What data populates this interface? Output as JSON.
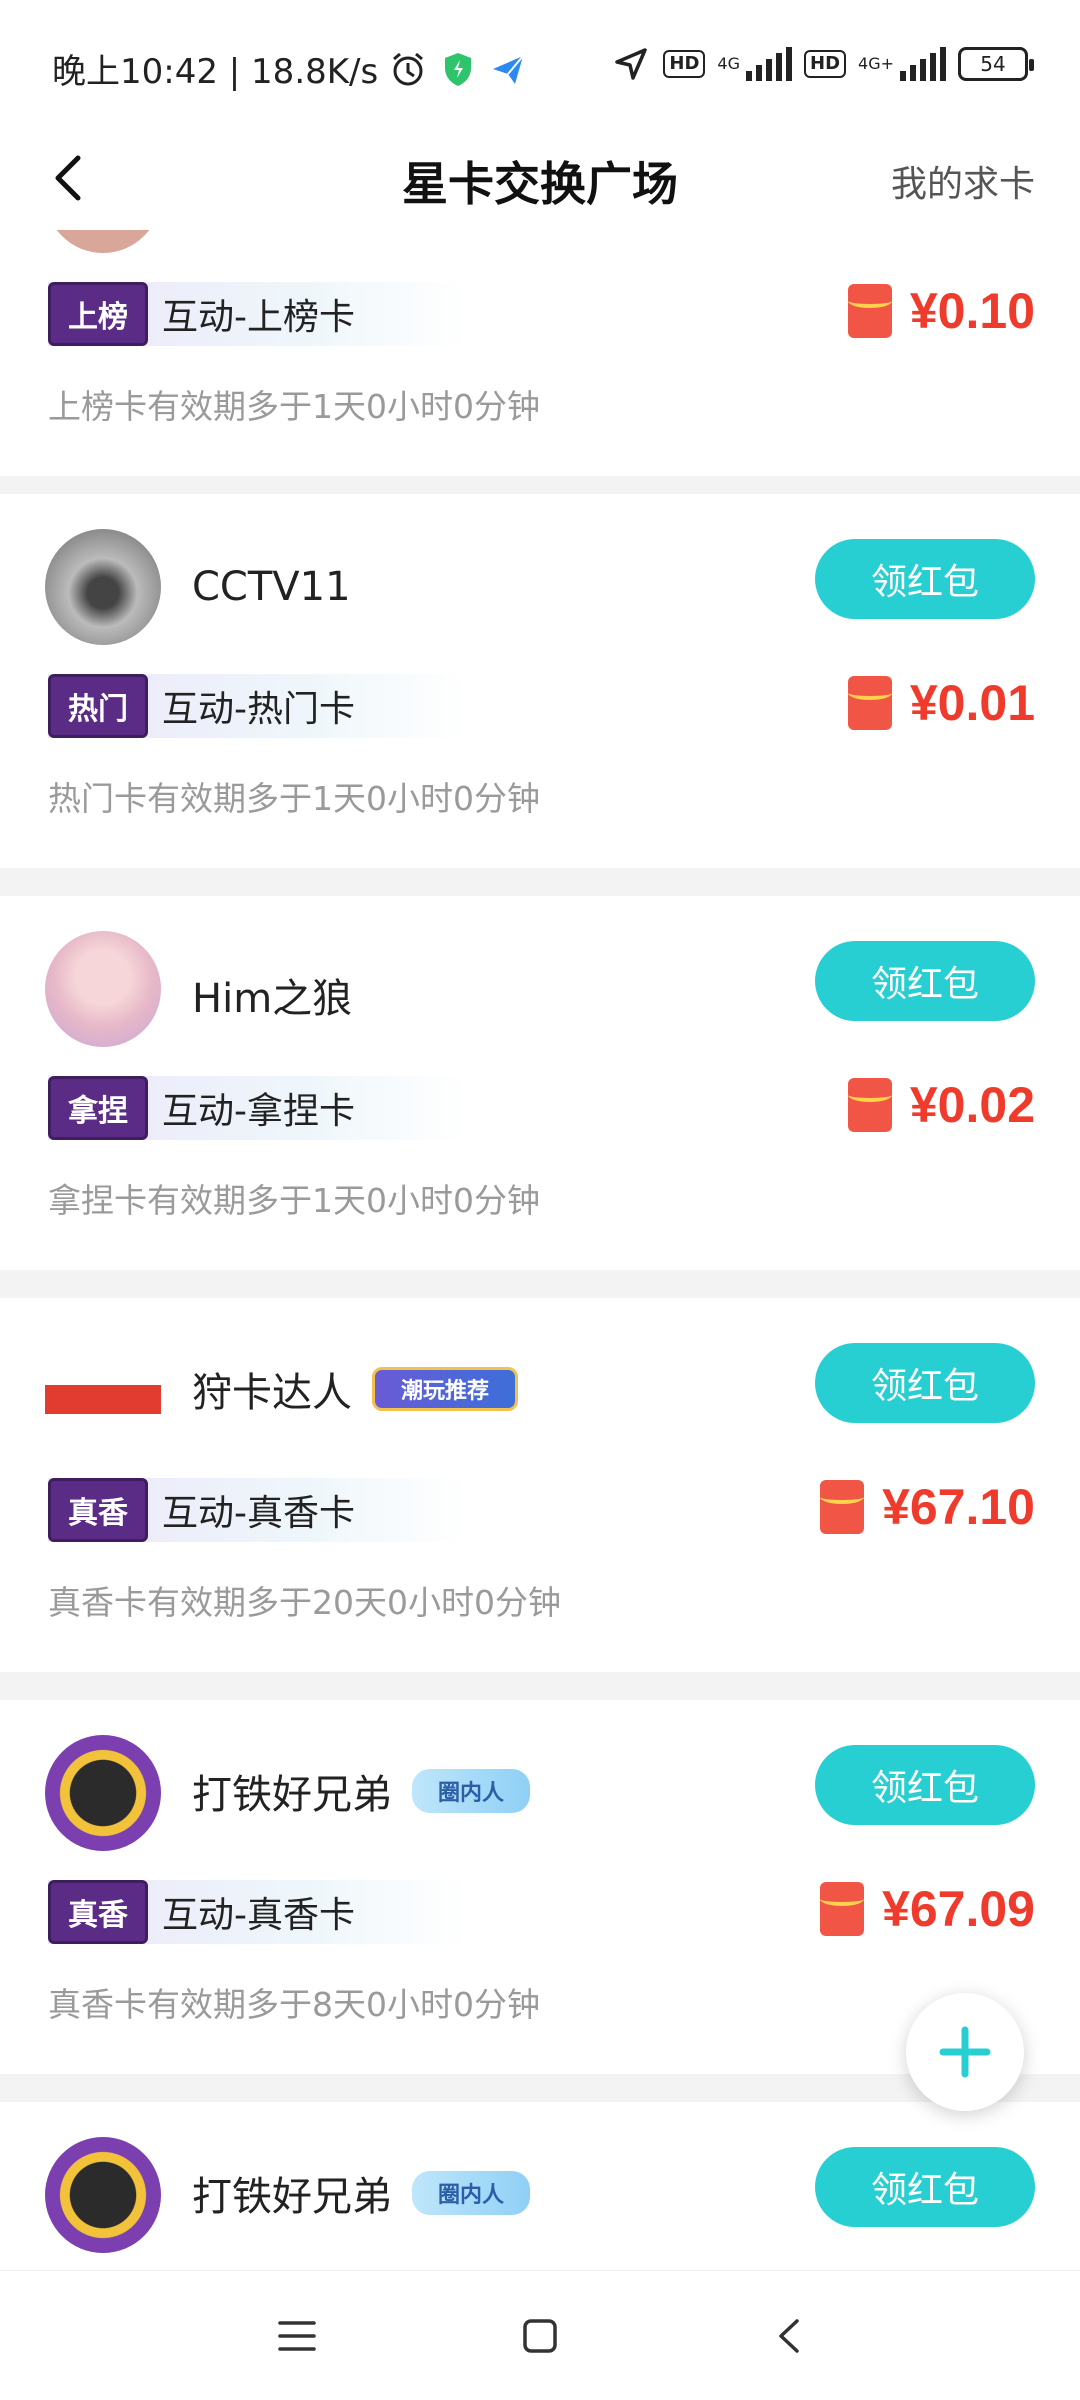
{
  "status_bar": {
    "time_text": "晚上10:42 | 18.8K/s",
    "hd1": "HD",
    "net1": "4G",
    "hd2": "HD",
    "net2": "4G+",
    "battery": "54",
    "icons": [
      "alarm-icon",
      "shield-icon",
      "send-icon",
      "location-icon"
    ]
  },
  "header": {
    "title": "星卡交换广场",
    "right_link": "我的求卡"
  },
  "cards": [
    {
      "user": "",
      "card_tag": "上榜",
      "card_name": "互动-上榜卡",
      "price": "¥0.10",
      "validity": "上榜卡有效期多于1天0小时0分钟"
    },
    {
      "user": "CCTV11",
      "button": "领红包",
      "card_tag": "热门",
      "card_name": "互动-热门卡",
      "price": "¥0.01",
      "validity": "热门卡有效期多于1天0小时0分钟"
    },
    {
      "user": "Him之狼",
      "button": "领红包",
      "card_tag": "拿捏",
      "card_name": "互动-拿捏卡",
      "price": "¥0.02",
      "validity": "拿捏卡有效期多于1天0小时0分钟"
    },
    {
      "user": "狩卡达人",
      "badge": "潮玩推荐",
      "button": "领红包",
      "card_tag": "真香",
      "card_name": "互动-真香卡",
      "price": "¥67.10",
      "validity": "真香卡有效期多于20天0小时0分钟"
    },
    {
      "user": "打铁好兄弟",
      "badge": "圈内人",
      "button": "领红包",
      "card_tag": "真香",
      "card_name": "互动-真香卡",
      "price": "¥67.09",
      "validity": "真香卡有效期多于8天0小时0分钟"
    },
    {
      "user": "打铁好兄弟",
      "badge": "圈内人",
      "button": "领红包"
    }
  ],
  "colors": {
    "accent": "#27cfd3",
    "price": "#ef3b2c",
    "tag_bg": "#5b2c86"
  }
}
